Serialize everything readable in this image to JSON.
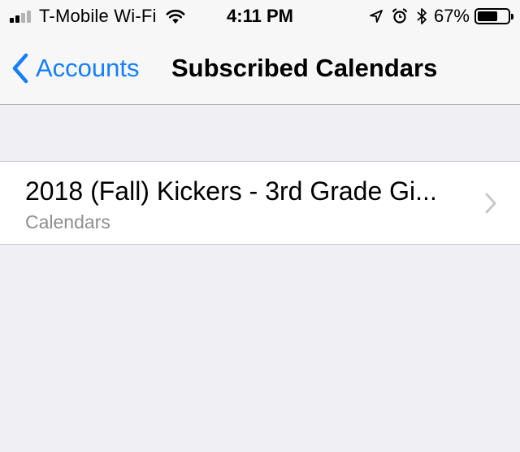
{
  "status_bar": {
    "carrier": "T-Mobile Wi-Fi",
    "time": "4:11 PM",
    "battery_percent": "67%",
    "battery_level": 0.67,
    "signal_bars_filled": 2,
    "signal_bars_total": 4,
    "icons": [
      "signal-icon",
      "wifi-icon",
      "location-arrow-icon",
      "alarm-icon",
      "bluetooth-icon",
      "battery-icon"
    ]
  },
  "nav": {
    "back_label": "Accounts",
    "title": "Subscribed Calendars"
  },
  "calendar_list": [
    {
      "title": "2018 (Fall) Kickers - 3rd Grade Gi...",
      "subtitle": "Calendars"
    }
  ],
  "colors": {
    "accent": "#147efb",
    "background": "#efeff4",
    "secondary_text": "#8e8e93",
    "chevron": "#c7c7cc"
  }
}
